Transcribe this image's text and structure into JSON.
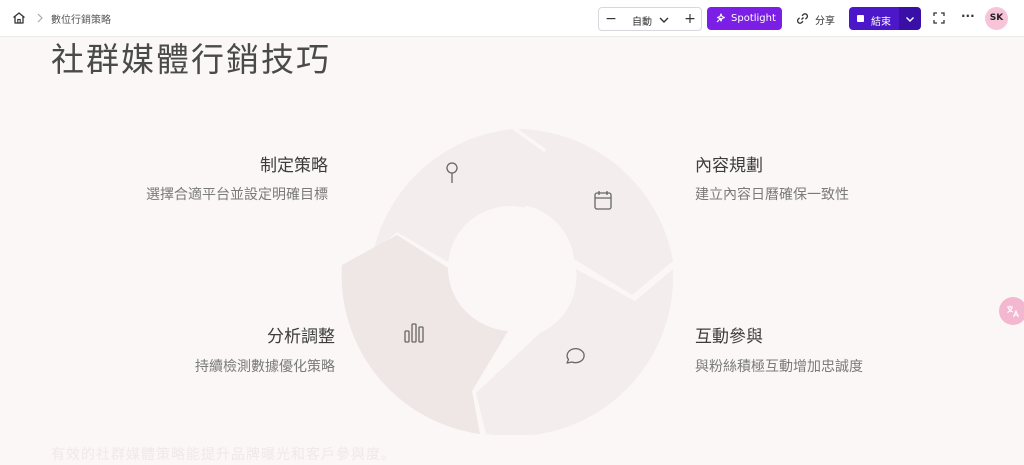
{
  "topbar": {
    "breadcrumb": "數位行銷策略",
    "zoom_label": "自動",
    "zoom_minus": "−",
    "zoom_plus": "+",
    "spotlight_label": "Spotlight",
    "share_label": "分享",
    "end_label": "結束",
    "more_label": "···",
    "avatar_initials": "SK"
  },
  "slide": {
    "title": "社群媒體行銷技巧",
    "steps": [
      {
        "title": "制定策略",
        "desc": "選擇合適平台並設定明確目標",
        "icon": "map-pin-icon"
      },
      {
        "title": "內容規劃",
        "desc": "建立內容日曆確保一致性",
        "icon": "calendar-icon"
      },
      {
        "title": "分析調整",
        "desc": "持續檢測數據優化策略",
        "icon": "bar-chart-icon"
      },
      {
        "title": "互動參與",
        "desc": "與粉絲積極互動增加忠誠度",
        "icon": "chat-bubble-icon"
      }
    ],
    "faded_footer": "有效的社群媒體策略能提升品牌曝光和客戶參與度。"
  },
  "colors": {
    "accent_spotlight": "#7b1fe6",
    "accent_end": "#4b17c9",
    "background": "#fbf7f6",
    "segment_light": "#f3eeed",
    "segment_dark": "#efe6e6",
    "avatar": "#f7c4da"
  }
}
